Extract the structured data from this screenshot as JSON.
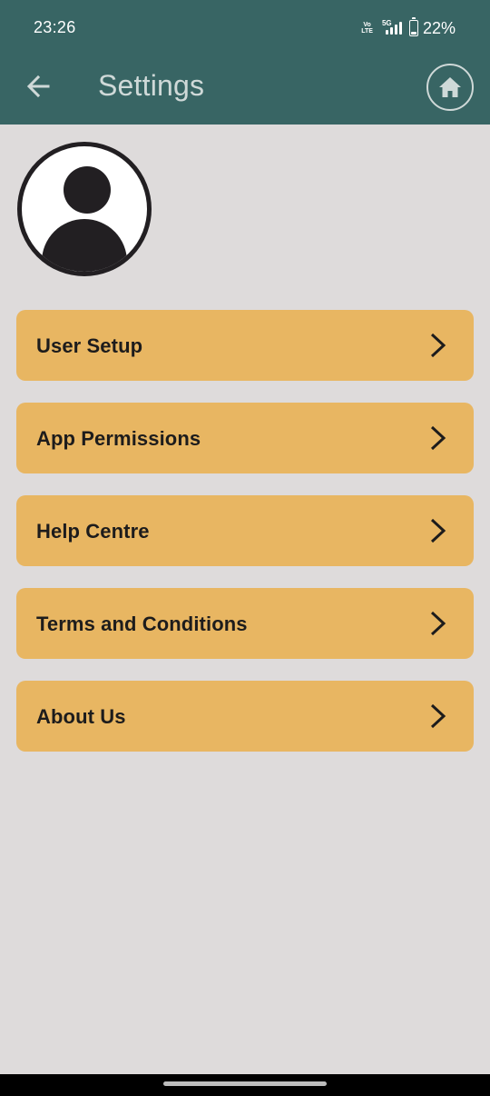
{
  "status_bar": {
    "time": "23:26",
    "volte_top": "Vo",
    "volte_bottom": "LTE",
    "network": "5G",
    "battery_level_percent": 22,
    "battery_text": "22%"
  },
  "app_bar": {
    "title": "Settings",
    "back_icon": "arrow-left-icon",
    "home_icon": "home-icon"
  },
  "profile": {
    "avatar_icon": "user-avatar-icon"
  },
  "menu": {
    "items": [
      {
        "label": "User Setup",
        "icon": "chevron-right-icon"
      },
      {
        "label": "App Permissions",
        "icon": "chevron-right-icon"
      },
      {
        "label": "Help Centre",
        "icon": "chevron-right-icon"
      },
      {
        "label": "Terms and Conditions",
        "icon": "chevron-right-icon"
      },
      {
        "label": "About Us",
        "icon": "chevron-right-icon"
      }
    ]
  },
  "colors": {
    "header": "#386564",
    "background": "#dedbdb",
    "menu_item": "#e8b662",
    "text_dark": "#1d1c1c",
    "title_text": "#cfd9d8"
  }
}
